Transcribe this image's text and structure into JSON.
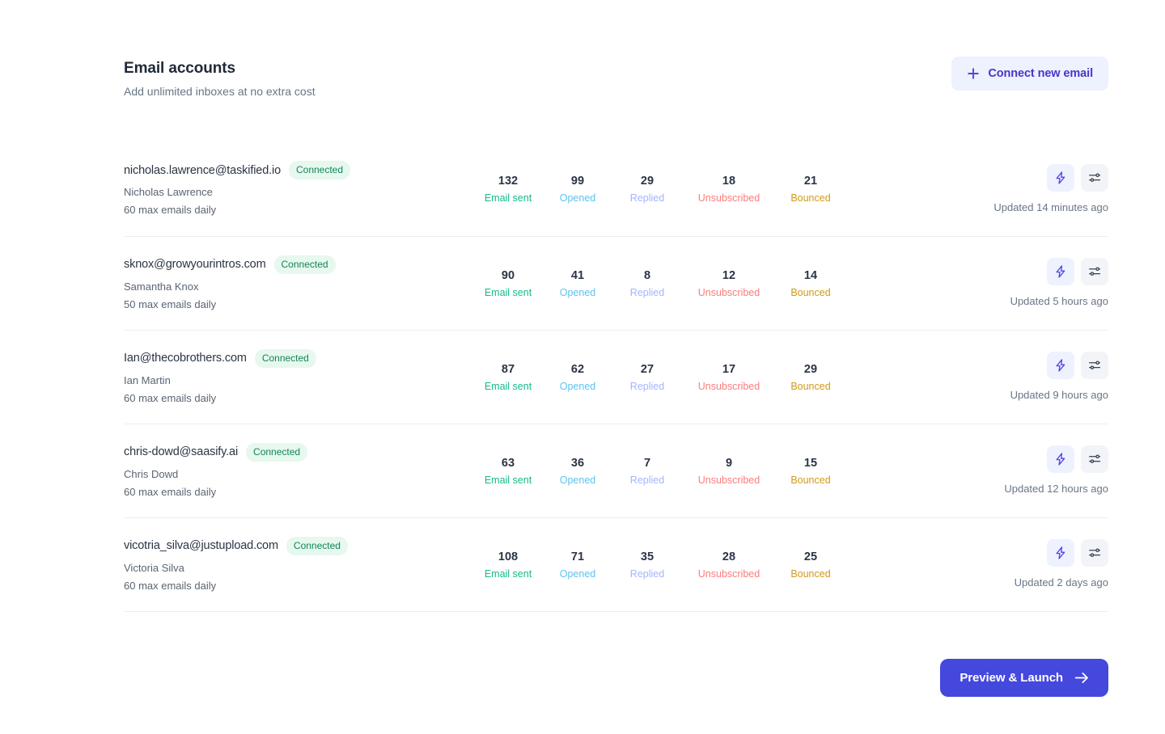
{
  "header": {
    "title": "Email accounts",
    "subtitle": "Add unlimited inboxes at no extra cost",
    "connect_button_label": "Connect new email",
    "connect_button_icon": "plus-icon",
    "accent_color": "#4338ca",
    "connect_button_bg": "#eef1fe"
  },
  "stat_columns": [
    {
      "key": "email_sent",
      "label": "Email sent",
      "color": "#17b98a"
    },
    {
      "key": "opened",
      "label": "Opened",
      "color": "#5cc2f0"
    },
    {
      "key": "replied",
      "label": "Replied",
      "color": "#a5b4fc"
    },
    {
      "key": "unsubscribed",
      "label": "Unsubscribed",
      "color": "#fb7d7d"
    },
    {
      "key": "bounced",
      "label": "Bounced",
      "color": "#d09a18"
    }
  ],
  "row_actions": {
    "bolt_icon": "lightning-bolt-icon",
    "settings_icon": "sliders-settings-icon"
  },
  "accounts": [
    {
      "email": "nicholas.lawrence@taskified.io",
      "status": "Connected",
      "name": "Nicholas Lawrence",
      "limit": "60 max emails daily",
      "stats": {
        "email_sent": "132",
        "opened": "99",
        "replied": "29",
        "unsubscribed": "18",
        "bounced": "21"
      },
      "updated": "Updated 14 minutes ago"
    },
    {
      "email": "sknox@growyourintros.com",
      "status": "Connected",
      "name": "Samantha Knox",
      "limit": "50 max emails daily",
      "stats": {
        "email_sent": "90",
        "opened": "41",
        "replied": "8",
        "unsubscribed": "12",
        "bounced": "14"
      },
      "updated": "Updated 5 hours ago"
    },
    {
      "email": "Ian@thecobrothers.com",
      "status": "Connected",
      "name": "Ian Martin",
      "limit": "60 max emails daily",
      "stats": {
        "email_sent": "87",
        "opened": "62",
        "replied": "27",
        "unsubscribed": "17",
        "bounced": "29"
      },
      "updated": "Updated 9 hours ago"
    },
    {
      "email": "chris-dowd@saasify.ai",
      "status": "Connected",
      "name": "Chris Dowd",
      "limit": "60 max emails daily",
      "stats": {
        "email_sent": "63",
        "opened": "36",
        "replied": "7",
        "unsubscribed": "9",
        "bounced": "15"
      },
      "updated": "Updated 12 hours ago"
    },
    {
      "email": "vicotria_silva@justupload.com",
      "status": "Connected",
      "name": "Victoria Silva",
      "limit": "60 max emails daily",
      "stats": {
        "email_sent": "108",
        "opened": "71",
        "replied": "35",
        "unsubscribed": "28",
        "bounced": "25"
      },
      "updated": "Updated 2 days ago"
    }
  ],
  "footer": {
    "launch_button_label": "Preview & Launch",
    "launch_button_icon": "arrow-right-icon",
    "launch_button_bg": "#4448dd"
  }
}
